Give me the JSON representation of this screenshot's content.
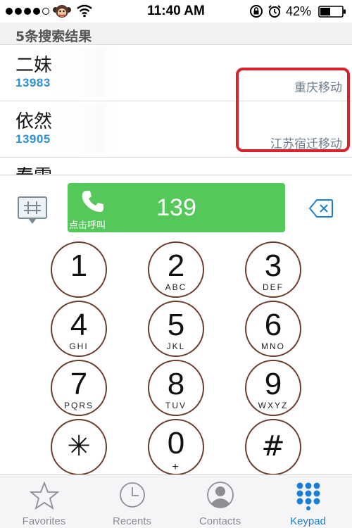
{
  "status_bar": {
    "time": "11:40 AM",
    "battery_percent": "42%",
    "signal_bars_filled": 4,
    "icons": [
      "carrier-logo-icon",
      "wifi-icon",
      "rotation-lock-icon",
      "alarm-icon",
      "battery-icon"
    ]
  },
  "results": {
    "header": "5条搜索结果",
    "items": [
      {
        "name": "二妹",
        "number": "13983",
        "location": "重庆移动"
      },
      {
        "name": "依然",
        "number": "13905",
        "location": "江苏宿迁移动"
      }
    ],
    "partial_item_name": "春雷"
  },
  "dialer": {
    "dialed_number": "139",
    "call_hint": "点击呼叫",
    "call_color": "#54c95a",
    "keys": [
      {
        "digit": "1",
        "letters": ""
      },
      {
        "digit": "2",
        "letters": "ABC"
      },
      {
        "digit": "3",
        "letters": "DEF"
      },
      {
        "digit": "4",
        "letters": "GHI"
      },
      {
        "digit": "5",
        "letters": "JKL"
      },
      {
        "digit": "6",
        "letters": "MNO"
      },
      {
        "digit": "7",
        "letters": "PQRS"
      },
      {
        "digit": "8",
        "letters": "TUV"
      },
      {
        "digit": "9",
        "letters": "WXYZ"
      },
      {
        "digit": "✳",
        "letters": ""
      },
      {
        "digit": "0",
        "letters": "+"
      },
      {
        "digit": "#",
        "letters": ""
      }
    ]
  },
  "tab_bar": {
    "tabs": [
      {
        "label": "Favorites",
        "icon": "star-icon",
        "active": false
      },
      {
        "label": "Recents",
        "icon": "clock-icon",
        "active": false
      },
      {
        "label": "Contacts",
        "icon": "person-icon",
        "active": false
      },
      {
        "label": "Keypad",
        "icon": "keypad-icon",
        "active": true
      }
    ],
    "active_color": "#1a7fd4"
  },
  "colors": {
    "highlight_border": "#d9232a",
    "number_blue": "#2f8fd5"
  }
}
